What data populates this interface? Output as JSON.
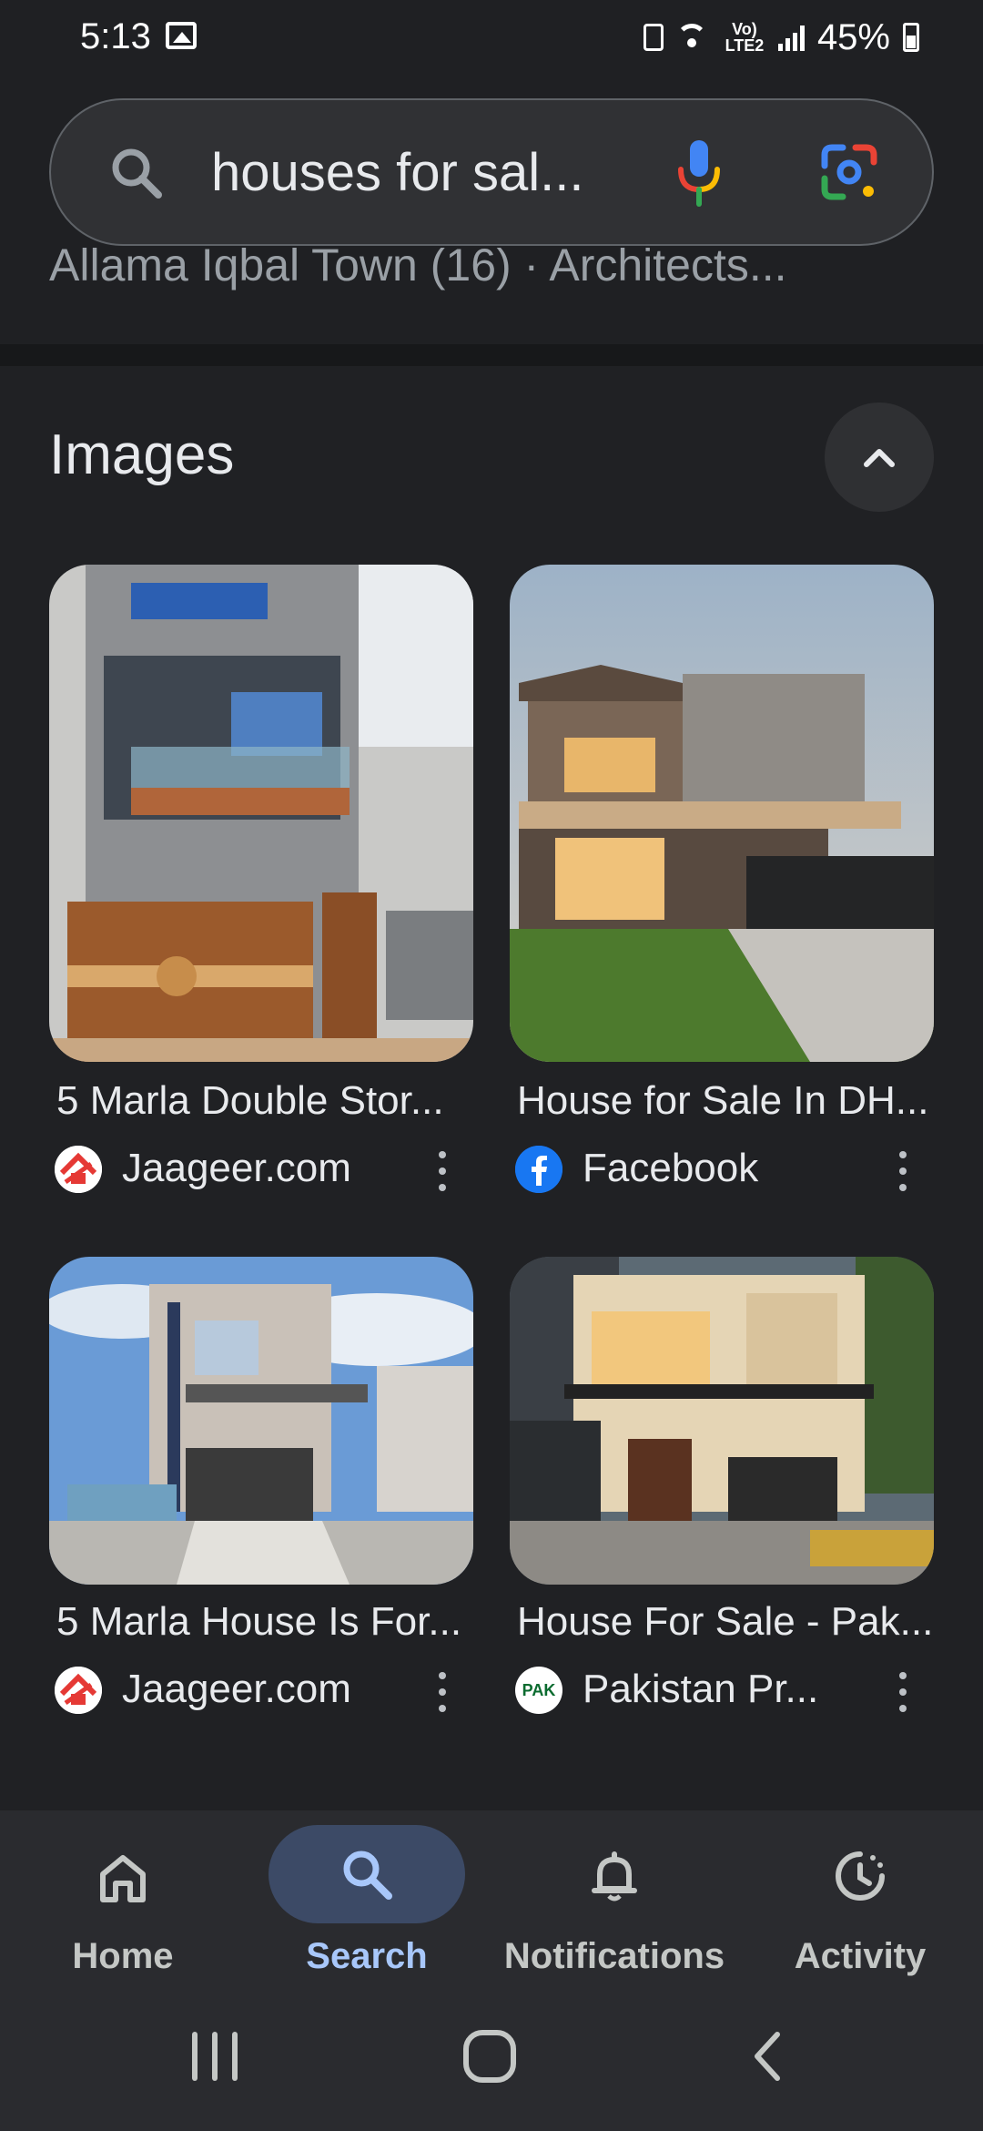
{
  "status_bar": {
    "time": "5:13",
    "battery": "45%",
    "network": "Vo) LTE2"
  },
  "search": {
    "query": "houses for sal...",
    "icons": [
      "search-icon",
      "mic-icon",
      "google-lens-icon"
    ]
  },
  "previous_result_line": "Allama Iqbal Town (16) · Architects...",
  "images_section": {
    "title": "Images",
    "collapse_icon": "chevron-up-icon",
    "results": [
      {
        "title": "5 Marla Double Stor...",
        "source": "Jaageer.com",
        "favicon": "jaageer-favicon"
      },
      {
        "title": "House for Sale In DH...",
        "source": "Facebook",
        "favicon": "facebook-favicon"
      },
      {
        "title": "5 Marla House Is For...",
        "source": "Jaageer.com",
        "favicon": "jaageer-favicon"
      },
      {
        "title": "House For Sale - Pak...",
        "source": "Pakistan Pr...",
        "favicon": "pakistan-property-favicon",
        "favicon_text": "PAK"
      }
    ]
  },
  "bottom_nav": {
    "items": [
      {
        "label": "Home",
        "icon": "home-icon"
      },
      {
        "label": "Search",
        "icon": "search-icon",
        "active": true
      },
      {
        "label": "Notifications",
        "icon": "bell-icon"
      },
      {
        "label": "Activity",
        "icon": "activity-icon"
      }
    ]
  },
  "system_nav": [
    "recents-button",
    "home-button",
    "back-button"
  ],
  "colors": {
    "accent": "#a8c7fa",
    "background": "#202124",
    "search_bg": "#303134"
  }
}
